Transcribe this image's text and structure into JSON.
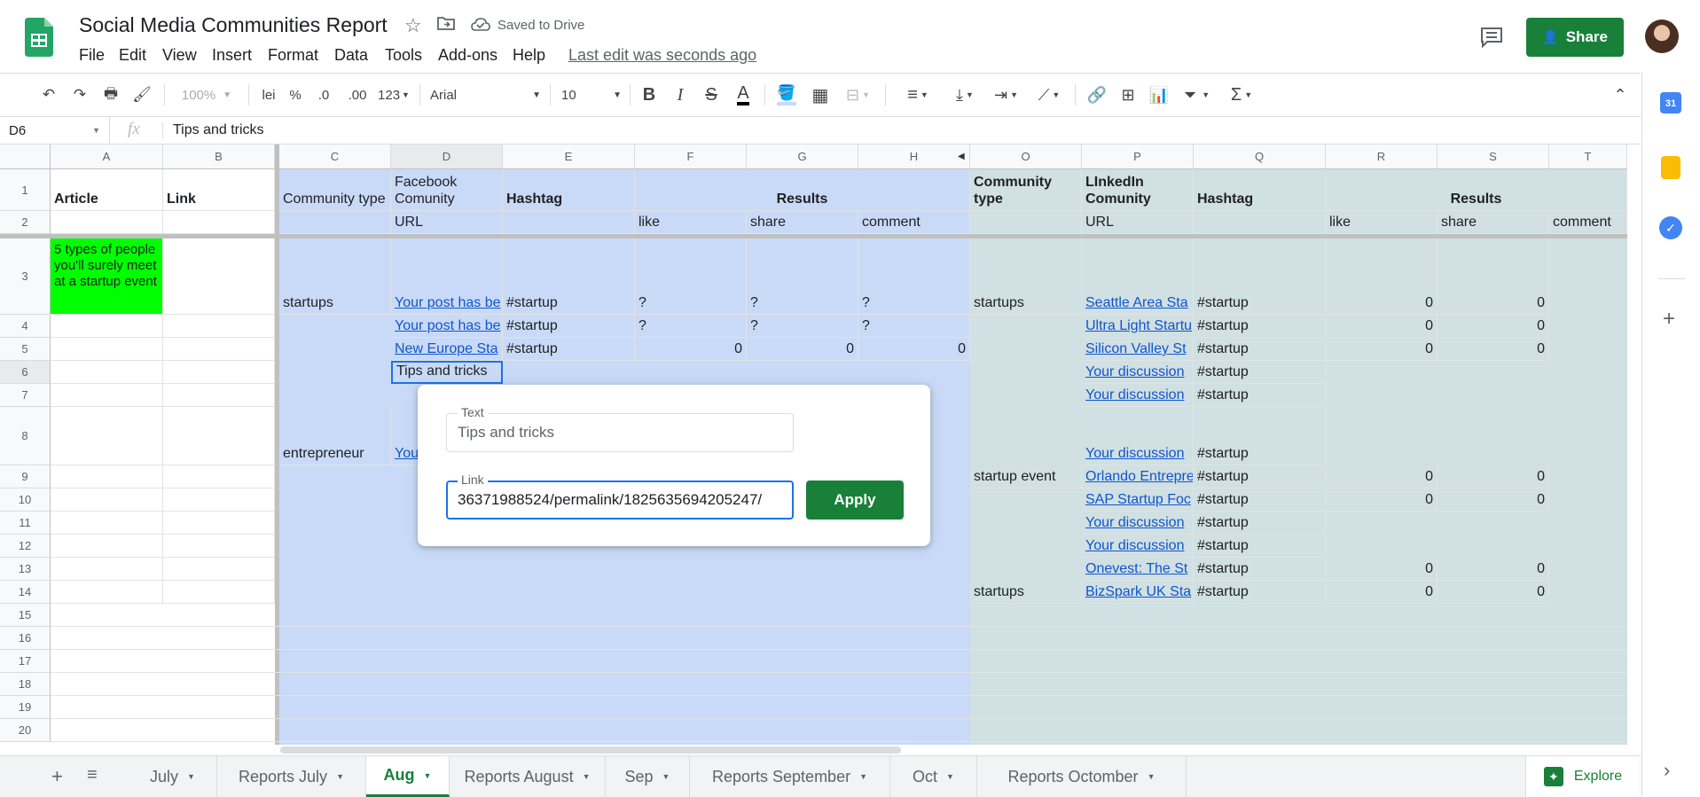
{
  "doc": {
    "title": "Social Media Communities Report",
    "saved_status": "Saved to Drive",
    "last_edit": "Last edit was seconds ago",
    "share_label": "Share"
  },
  "menu": [
    "File",
    "Edit",
    "View",
    "Insert",
    "Format",
    "Data",
    "Tools",
    "Add-ons",
    "Help"
  ],
  "toolbar": {
    "zoom": "100%",
    "currency": "lei",
    "percent": "%",
    "dec_less": ".0",
    "dec_more": ".00",
    "format_more": "123",
    "font": "Arial",
    "font_size": "10"
  },
  "formula_bar": {
    "cell_ref": "D6",
    "fx": "fx",
    "content": "Tips and tricks"
  },
  "columns": [
    "A",
    "B",
    "C",
    "D",
    "E",
    "F",
    "G",
    "H",
    "O",
    "P",
    "Q",
    "R",
    "S",
    "T"
  ],
  "rows": [
    "1",
    "2",
    "3",
    "4",
    "5",
    "6",
    "7",
    "8",
    "9",
    "10",
    "11",
    "12",
    "13",
    "14",
    "15",
    "16",
    "17",
    "18",
    "19",
    "20"
  ],
  "header": {
    "a1": "Article",
    "b1": "Link",
    "c1": "Community type",
    "d1": "Facebook Comunity",
    "e1": "Hashtag",
    "results": "Results",
    "o1": "Community type",
    "p1": "LInkedIn Comunity",
    "q1": "Hashtag",
    "results2": "Results",
    "d2": "URL",
    "f2": "like",
    "g2": "share",
    "h2": "comment",
    "p2": "URL",
    "r2": "like",
    "s2": "share",
    "t2": "comment"
  },
  "cells": {
    "a3": "5 types of people you'll surely meet at a startup event",
    "c3": "startups",
    "d3": "Your post has be",
    "e3": "#startup",
    "f3": "?",
    "g3": "?",
    "h3": "?",
    "o3": "startups",
    "p3": "Seattle Area Sta",
    "q3": "#startup",
    "r3": "0",
    "s3": "0",
    "d4": "Your post has be",
    "e4": "#startup",
    "f4": "?",
    "g4": "?",
    "h4": "?",
    "p4": "Ultra Light Startu",
    "q4": "#startup",
    "r4": "0",
    "s4": "0",
    "d5": "New Europe Sta",
    "e5": "#startup",
    "f5": "0",
    "g5": "0",
    "h5": "0",
    "p5": "Silicon Valley St",
    "q5": "#startup",
    "r5": "0",
    "s5": "0",
    "d6": "Tips and tricks",
    "p6": "Your discussion",
    "q6": "#startup",
    "p7": "Your discussion",
    "q7": "#startup",
    "c8": "entrepreneur",
    "d8": "You",
    "p8": "Your discussion",
    "q8": "#startup",
    "o9": "startup event",
    "p9": "Orlando Entrepre",
    "q9": "#startup",
    "r9": "0",
    "s9": "0",
    "p10": "SAP Startup Foc",
    "q10": "#startup",
    "r10": "0",
    "s10": "0",
    "p11": "Your discussion",
    "q11": "#startup",
    "p12": "Your discussion",
    "q12": "#startup",
    "p13": "Onevest: The St",
    "q13": "#startup",
    "r13": "0",
    "s13": "0",
    "o14": "startups",
    "p14": "BizSpark UK Sta",
    "q14": "#startup",
    "r14": "0",
    "s14": "0"
  },
  "link_popup": {
    "text_label": "Text",
    "text_value": "Tips and tricks",
    "link_label": "Link",
    "link_value": "36371988524/permalink/1825635694205247/",
    "apply_label": "Apply"
  },
  "sheet_tabs": [
    "July",
    "Reports July",
    "Aug",
    "Reports August",
    "Sep",
    "Reports September",
    "Oct",
    "Reports Octomber"
  ],
  "active_tab": "Aug",
  "explore_label": "Explore",
  "colors": {
    "accent_green": "#188038",
    "fb_fill": "#c9daf8",
    "li_fill": "#d0e0e3",
    "article_fill": "#00ff00"
  }
}
